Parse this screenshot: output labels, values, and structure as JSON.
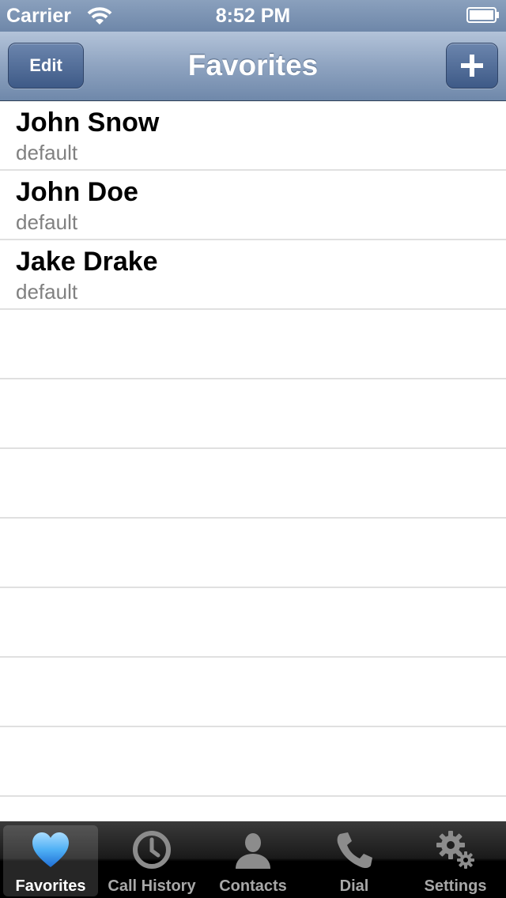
{
  "status_bar": {
    "carrier": "Carrier",
    "time": "8:52 PM"
  },
  "nav": {
    "edit_label": "Edit",
    "title": "Favorites",
    "add_icon": "plus-icon"
  },
  "favorites": [
    {
      "name": "John Snow",
      "label": "default"
    },
    {
      "name": "John Doe",
      "label": "default"
    },
    {
      "name": "Jake Drake",
      "label": "default"
    }
  ],
  "tab_bar": {
    "selected": "favorites",
    "tabs": [
      {
        "id": "favorites",
        "label": "Favorites",
        "icon": "heart-icon"
      },
      {
        "id": "call-history",
        "label": "Call History",
        "icon": "clock-icon"
      },
      {
        "id": "contacts",
        "label": "Contacts",
        "icon": "person-icon"
      },
      {
        "id": "dial",
        "label": "Dial",
        "icon": "phone-icon"
      },
      {
        "id": "settings",
        "label": "Settings",
        "icon": "gears-icon"
      }
    ]
  },
  "colors": {
    "nav_gradient_top": "#b3c3d9",
    "nav_gradient_bottom": "#6f88aa",
    "button_blue": "#3e5a87",
    "selected_tab_icon": "#3f9cf0",
    "subtitle_gray": "#808080"
  }
}
